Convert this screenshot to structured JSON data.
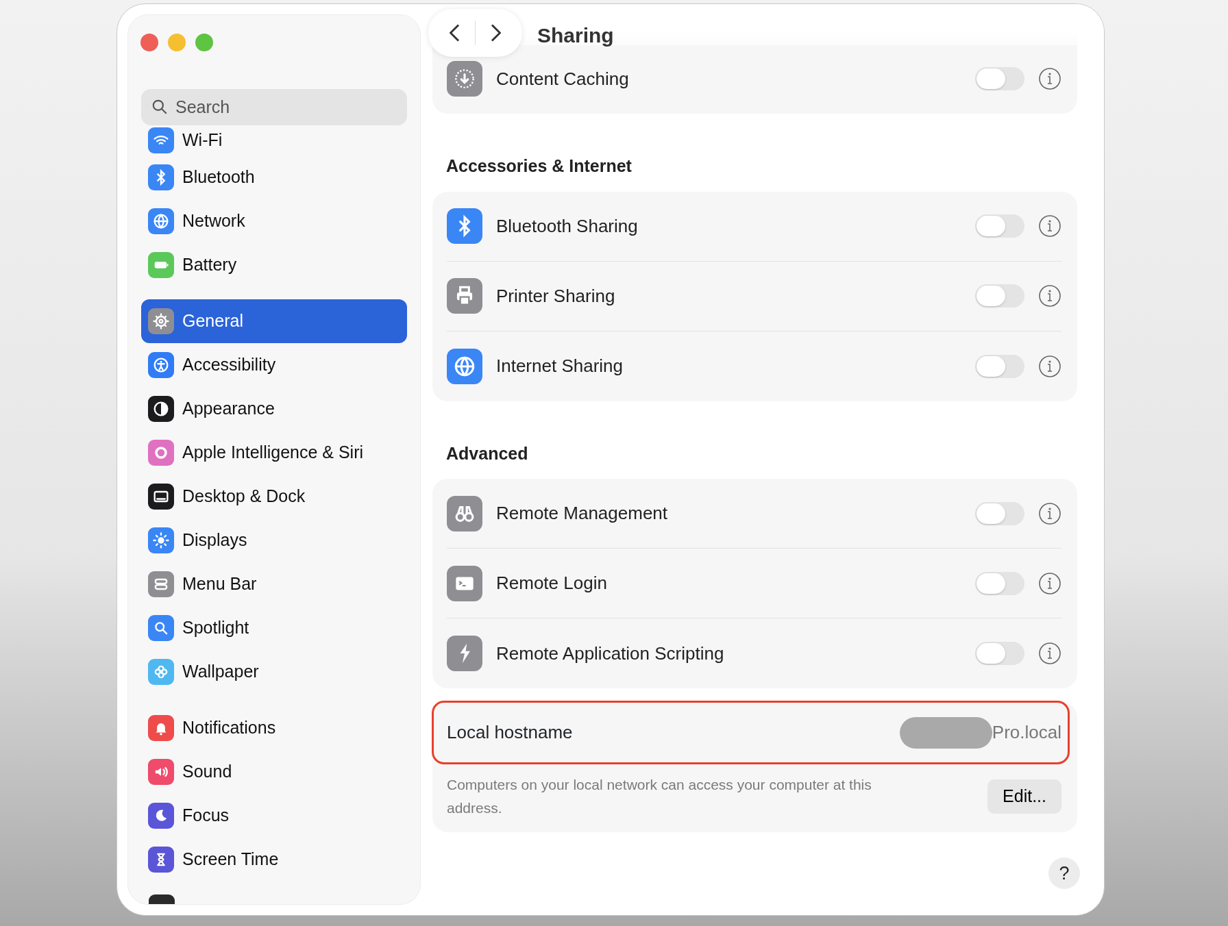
{
  "window": {
    "title": "Sharing",
    "controls": [
      {
        "color": "#ee5f57"
      },
      {
        "color": "#f5bf2f"
      },
      {
        "color": "#5ec442"
      }
    ]
  },
  "sidebar": {
    "search": {
      "placeholder": "Search"
    },
    "groups": [
      [
        {
          "label": "Wi-Fi",
          "selected": false,
          "color": "#3a86f5"
        }
      ],
      [
        {
          "label": "Bluetooth",
          "selected": false,
          "color": "#3a86f5"
        },
        {
          "label": "Network",
          "selected": false,
          "color": "#3a86f5"
        },
        {
          "label": "Battery",
          "selected": false,
          "color": "#5bc85a"
        }
      ],
      [
        {
          "label": "General",
          "selected": true,
          "color": "#8e8e93"
        },
        {
          "label": "Accessibility",
          "selected": false,
          "color": "#2f7cf6"
        },
        {
          "label": "Appearance",
          "selected": false,
          "color": "#1c1c1e"
        },
        {
          "label": "Apple Intelligence & Siri",
          "selected": false,
          "color": "#e070c0"
        },
        {
          "label": "Desktop & Dock",
          "selected": false,
          "color": "#1c1c1e"
        },
        {
          "label": "Displays",
          "selected": false,
          "color": "#3a86f5"
        },
        {
          "label": "Menu Bar",
          "selected": false,
          "color": "#8e8e93"
        },
        {
          "label": "Spotlight",
          "selected": false,
          "color": "#3a86f5"
        },
        {
          "label": "Wallpaper",
          "selected": false,
          "color": "#4fb8f0"
        }
      ],
      [
        {
          "label": "Notifications",
          "selected": false,
          "color": "#ef4b4b"
        },
        {
          "label": "Sound",
          "selected": false,
          "color": "#ef4b6b"
        },
        {
          "label": "Focus",
          "selected": false,
          "color": "#5b55d8"
        },
        {
          "label": "Screen Time",
          "selected": false,
          "color": "#5b55d8"
        }
      ]
    ]
  },
  "sections": [
    {
      "rows": [
        {
          "label": "Content Caching",
          "on": false,
          "color": "#8e8e93"
        }
      ]
    },
    {
      "heading": "Accessories & Internet",
      "rows": [
        {
          "label": "Bluetooth Sharing",
          "on": false,
          "color": "#3a86f5"
        },
        {
          "label": "Printer Sharing",
          "on": false,
          "color": "#8e8e93"
        },
        {
          "label": "Internet Sharing",
          "on": false,
          "color": "#3a86f5"
        }
      ]
    },
    {
      "heading": "Advanced",
      "rows": [
        {
          "label": "Remote Management",
          "on": false,
          "color": "#8e8e93"
        },
        {
          "label": "Remote Login",
          "on": false,
          "color": "#8e8e93"
        },
        {
          "label": "Remote Application Scripting",
          "on": false,
          "color": "#8e8e93"
        }
      ]
    }
  ],
  "hostname": {
    "label": "Local hostname",
    "value": "Pro.local",
    "highlighted": true,
    "description": "Computers on your local network can access your computer at this address.",
    "button": "Edit..."
  },
  "help_button": "?"
}
